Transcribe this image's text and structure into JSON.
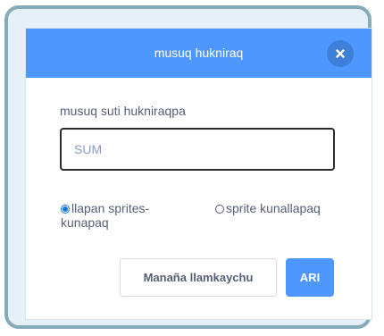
{
  "dialog": {
    "title": "musuq hukniraq",
    "prompt": "musuq suti hukniraqpa",
    "name_input": {
      "value": "",
      "placeholder": "SUM"
    },
    "options": [
      {
        "label": "llapan sprites-kunapaq",
        "selected": true
      },
      {
        "label": "sprite kunallapaq",
        "selected": false
      }
    ],
    "cancel_label": "Manaña llamkaychu",
    "ok_label": "ARI"
  },
  "colors": {
    "header": "#4d97ff",
    "close_button": "#3d7fd9",
    "frame_border": "#86aab8",
    "frame_fill": "#e6f0f8",
    "text": "#575e75",
    "radio_selected": "#1a73e8"
  },
  "icons": {
    "close": "close-icon"
  }
}
